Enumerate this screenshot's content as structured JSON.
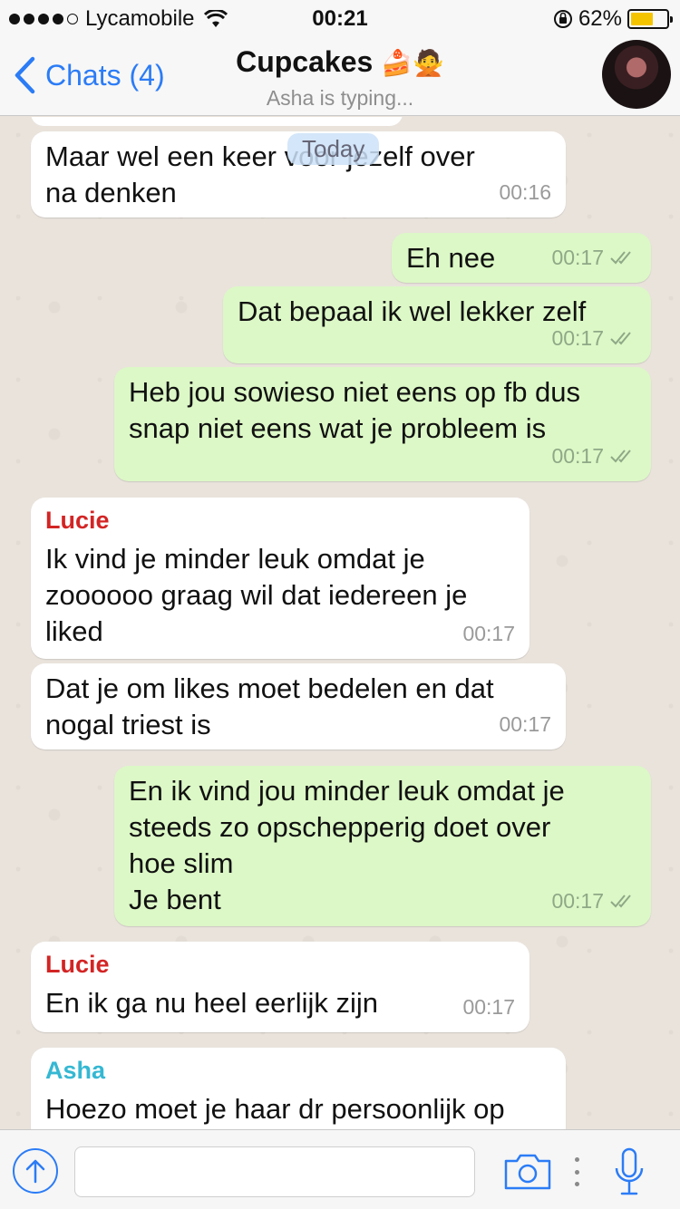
{
  "status_bar": {
    "carrier": "Lycamobile",
    "time": "00:21",
    "battery": "62%",
    "battery_level": 0.62
  },
  "nav": {
    "back_label": "Chats (4)",
    "title": "Cupcakes",
    "title_emoji": "🍰🙅",
    "subtitle": "Asha is typing..."
  },
  "date_pill": "Today",
  "messages": [
    {
      "dir": "in",
      "text": "Maar wel een keer voor jezelf over\nna denken",
      "time": "00:16"
    },
    {
      "dir": "out",
      "text": "Eh nee",
      "time": "00:17"
    },
    {
      "dir": "out",
      "text": "Dat bepaal ik wel lekker zelf",
      "time": "00:17"
    },
    {
      "dir": "out",
      "text": "Heb jou sowieso niet eens op fb dus\nsnap niet eens wat je probleem is",
      "time": "00:17"
    },
    {
      "dir": "in",
      "sender": "Lucie",
      "text": "Ik vind je minder leuk omdat je\nzoooooo graag wil dat iedereen je\nliked",
      "time": "00:17"
    },
    {
      "dir": "in",
      "text": "Dat je om likes moet bedelen en dat\nnogal triest is",
      "time": "00:17"
    },
    {
      "dir": "out",
      "text": "En ik vind jou minder leuk omdat je\nsteeds zo opschepperig doet over\nhoe slim\nJe bent",
      "time": "00:17"
    },
    {
      "dir": "in",
      "sender": "Lucie",
      "text": "En ik ga nu heel eerlijk zijn",
      "time": "00:17"
    },
    {
      "dir": "in",
      "sender": "Asha",
      "text": "Hoezo moet je haar dr persoonlijk op",
      "time": ""
    }
  ],
  "icons": {
    "signal": "signal-dots-icon",
    "wifi": "wifi-icon",
    "rotation_lock": "rotation-lock-icon",
    "battery": "battery-icon",
    "back": "chevron-left-icon",
    "share": "share-arrow-icon",
    "camera": "camera-icon",
    "more": "more-dots-icon",
    "mic": "microphone-icon"
  },
  "colors": {
    "accent": "#2b7cf6",
    "incoming_bubble": "#ffffff",
    "outgoing_bubble": "#dcf8c6",
    "sender_lucie": "#d32424",
    "sender_asha": "#35b8d3",
    "battery_fill": "#f5c400"
  }
}
